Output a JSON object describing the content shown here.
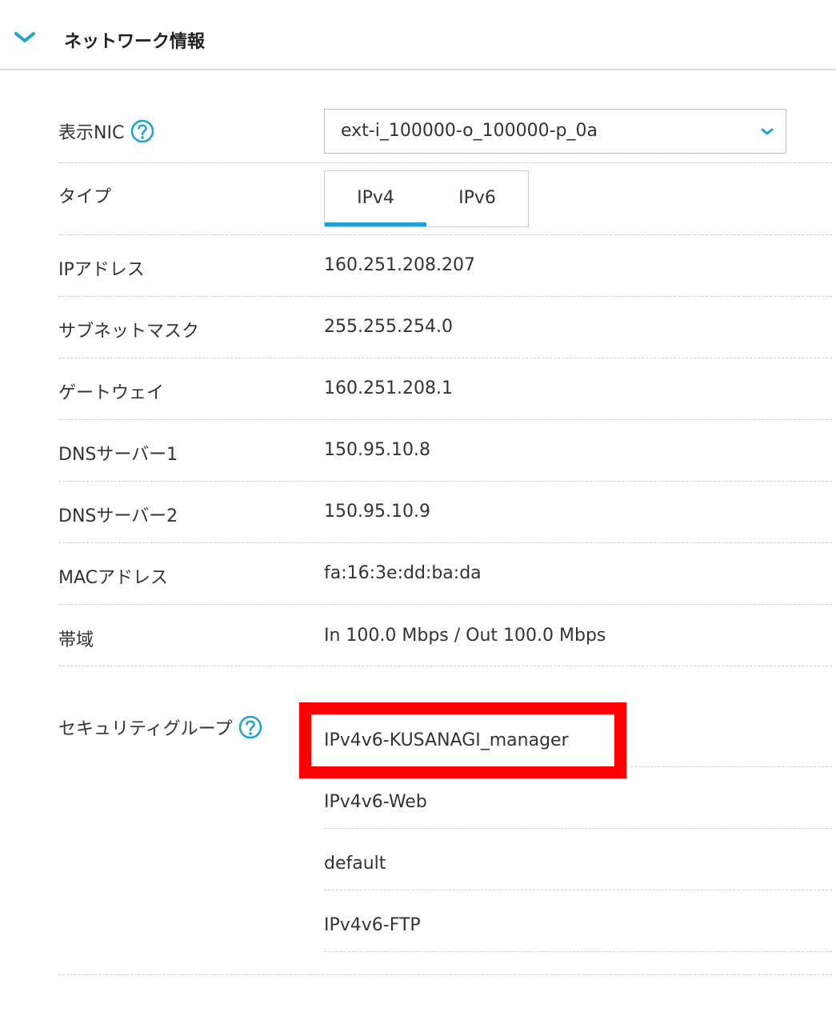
{
  "section": {
    "title": "ネットワーク情報",
    "toggle_icon": "chevron-down-icon"
  },
  "fields": {
    "nic": {
      "label": "表示NIC",
      "value": "ext-i_100000-o_100000-p_0a"
    },
    "type": {
      "label": "タイプ",
      "tabs": [
        "IPv4",
        "IPv6"
      ],
      "active_tab": "IPv4"
    },
    "ip": {
      "label": "IPアドレス",
      "value": "160.251.208.207"
    },
    "subnet": {
      "label": "サブネットマスク",
      "value": "255.255.254.0"
    },
    "gateway": {
      "label": "ゲートウェイ",
      "value": "160.251.208.1"
    },
    "dns1": {
      "label": "DNSサーバー1",
      "value": "150.95.10.8"
    },
    "dns2": {
      "label": "DNSサーバー2",
      "value": "150.95.10.9"
    },
    "mac": {
      "label": "MACアドレス",
      "value": "fa:16:3e:dd:ba:da"
    },
    "bandwidth": {
      "label": "帯域",
      "value": "In 100.0 Mbps / Out 100.0 Mbps"
    },
    "security_groups": {
      "label": "セキュリティグループ",
      "items": [
        "IPv4v6-KUSANAGI_manager",
        "IPv4v6-Web",
        "default",
        "IPv4v6-FTP"
      ]
    }
  },
  "colors": {
    "accent": "#1fa2d6",
    "highlight": "#ff0000",
    "divider": "#cfcfcf"
  }
}
